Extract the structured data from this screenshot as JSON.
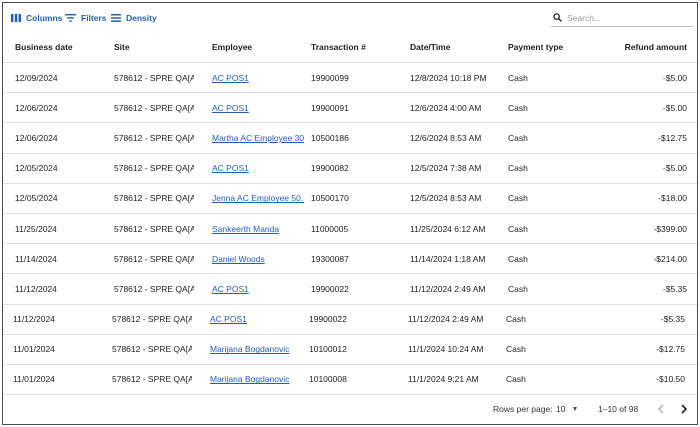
{
  "toolbar": {
    "columns_label": "Columns",
    "filters_label": "Filters",
    "density_label": "Density",
    "search_placeholder": "Search..."
  },
  "table": {
    "columns": [
      "Business date",
      "Site",
      "Employee",
      "Transaction #",
      "Date/Time",
      "Payment type",
      "Refund amount"
    ],
    "rows": [
      [
        "12/09/2024",
        "578612 - SPRE QA[A...",
        "AC POS1",
        "19900099",
        "12/8/2024 10:18 PM",
        "Cash",
        "-$5.00"
      ],
      [
        "12/06/2024",
        "578612 - SPRE QA[A...",
        "AC POS1",
        "19900091",
        "12/6/2024 4:00 AM",
        "Cash",
        "-$5.00"
      ],
      [
        "12/06/2024",
        "578612 - SPRE QA[A...",
        "Martha AC Employee 30",
        "10500186",
        "12/6/2024 8:53 AM",
        "Cash",
        "-$12.75"
      ],
      [
        "12/05/2024",
        "578612 - SPRE QA[A...",
        "AC POS1",
        "19900082",
        "12/5/2024 7:38 AM",
        "Cash",
        "-$5.00"
      ],
      [
        "12/05/2024",
        "578612 - SPRE QA[A...",
        "Jenna AC Employee 50...",
        "10500170",
        "12/5/2024 8:53 AM",
        "Cash",
        "-$18.00"
      ],
      [
        "11/25/2024",
        "578612 - SPRE QA[A...",
        "Sankeerth Manda",
        "11000005",
        "11/25/2024 6:12 AM",
        "Cash",
        "-$399.00"
      ],
      [
        "11/14/2024",
        "578612 - SPRE QA[A...",
        "Daniel Woods",
        "19300087",
        "11/14/2024 1:18 AM",
        "Cash",
        "-$214.00"
      ],
      [
        "11/12/2024",
        "578612 - SPRE QA[A...",
        "AC POS1",
        "19900022",
        "11/12/2024 2:49 AM",
        "Cash",
        "-$5.35"
      ],
      [
        "11/12/2024",
        "578612 - SPRE QA[A...",
        "AC POS1",
        "19900022",
        "11/12/2024 2:49 AM",
        "Cash",
        "-$5.35"
      ],
      [
        "11/01/2024",
        "578612 - SPRE QA[A...",
        "Marijana Bogdanovic",
        "10100012",
        "11/1/2024 10:24 AM",
        "Cash",
        "-$12.75"
      ],
      [
        "11/01/2024",
        "578612 - SPRE QA[A...",
        "Marijana Bogdanovic",
        "10100008",
        "11/1/2024 9:21 AM",
        "Cash",
        "-$10.50"
      ]
    ]
  },
  "footer": {
    "rows_per_page_label": "Rows per page:",
    "rows_per_page_value": "10",
    "range_text": "1–10 of 98"
  },
  "colors": {
    "accent": "#1f5fb8",
    "border": "#e2e2e2"
  }
}
